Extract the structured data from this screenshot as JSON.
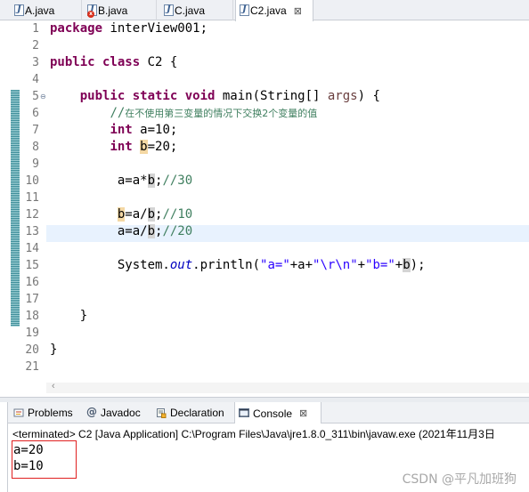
{
  "editor_tabs": [
    {
      "label": "A.java",
      "icon": "java-file-icon"
    },
    {
      "label": "B.java",
      "icon": "java-file-error-icon"
    },
    {
      "label": "C.java",
      "icon": "java-file-icon"
    },
    {
      "label": "C2.java",
      "icon": "java-file-icon",
      "active": true
    }
  ],
  "close_glyph": "⊠",
  "code": {
    "line_numbers": [
      "1",
      "2",
      "3",
      "4",
      "5",
      "6",
      "7",
      "8",
      "9",
      "10",
      "11",
      "12",
      "13",
      "14",
      "15",
      "16",
      "17",
      "18",
      "19",
      "20",
      "21"
    ],
    "l1_kw": "package",
    "l1_rest": " interView001;",
    "l3_kw": "public class",
    "l3_rest": " C2 {",
    "l5_kw": "public static void",
    "l5_rest": " main(String[] ",
    "l5_args": "args",
    "l5_end": ") {",
    "l6_comment_a": "//",
    "l6_comment_b": "在不使用第三变量的情况下交换2个变量的值",
    "l7_kw": "int",
    "l7_rest": " a=10;",
    "l8_kw": "int",
    "l8_b": "b",
    "l8_rest": "=20;",
    "l10_code": "a=a*",
    "l10_b": "b",
    "l10_semi": ";",
    "l10_comment": "//30",
    "l12_b1": "b",
    "l12_code": "=a/",
    "l12_b2": "b",
    "l12_semi": ";",
    "l12_comment": "//10",
    "l13_code": "a=a/",
    "l13_b": "b",
    "l13_semi": ";",
    "l13_comment": "//20",
    "l15_a": "System.",
    "l15_out": "out",
    "l15_b": ".println(",
    "l15_s1": "\"a=\"",
    "l15_c": "+a+",
    "l15_s2": "\"\\r\\n\"",
    "l15_d": "+",
    "l15_s3": "\"b=\"",
    "l15_e": "+",
    "l15_bvar": "b",
    "l15_f": ");",
    "l18": "}",
    "l20": "}"
  },
  "view_tabs": [
    {
      "label": "Problems",
      "icon": "problems-icon"
    },
    {
      "label": "Javadoc",
      "icon": "javadoc-icon"
    },
    {
      "label": "Declaration",
      "icon": "declaration-icon"
    },
    {
      "label": "Console",
      "icon": "console-icon",
      "active": true
    }
  ],
  "console": {
    "status": "<terminated> C2 [Java Application] C:\\Program Files\\Java\\jre1.8.0_311\\bin\\javaw.exe (2021年11月3日",
    "output": [
      "a=20",
      "b=10"
    ]
  },
  "watermark": "CSDN @平凡加班狗",
  "colors": {
    "keyword": "#7f0055",
    "comment": "#3f7f5f",
    "string": "#2a00ff",
    "static_field": "#0000c0",
    "highlight_box": "#e02020"
  }
}
